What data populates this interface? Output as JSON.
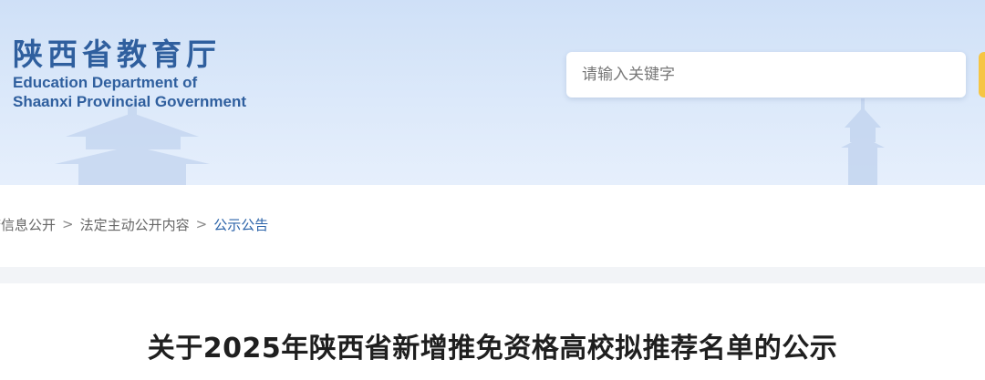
{
  "header": {
    "logo_cn": "陕西省教育厅",
    "logo_en_line1": "Education Department of",
    "logo_en_line2": "Shaanxi Provincial Government",
    "search": {
      "placeholder": "请输入关键字",
      "value": ""
    }
  },
  "breadcrumb": {
    "items": [
      "府信息公开",
      "法定主动公开内容"
    ],
    "separator": ">",
    "current": "公示公告"
  },
  "article": {
    "title": "关于2025年陕西省新增推免资格高校拟推荐名单的公示"
  },
  "colors": {
    "brand_blue": "#2f5f9e",
    "link_blue": "#2a62a8",
    "search_accent": "#f6c543"
  },
  "icons": [
    "pagoda-watermark",
    "tower-watermark"
  ]
}
